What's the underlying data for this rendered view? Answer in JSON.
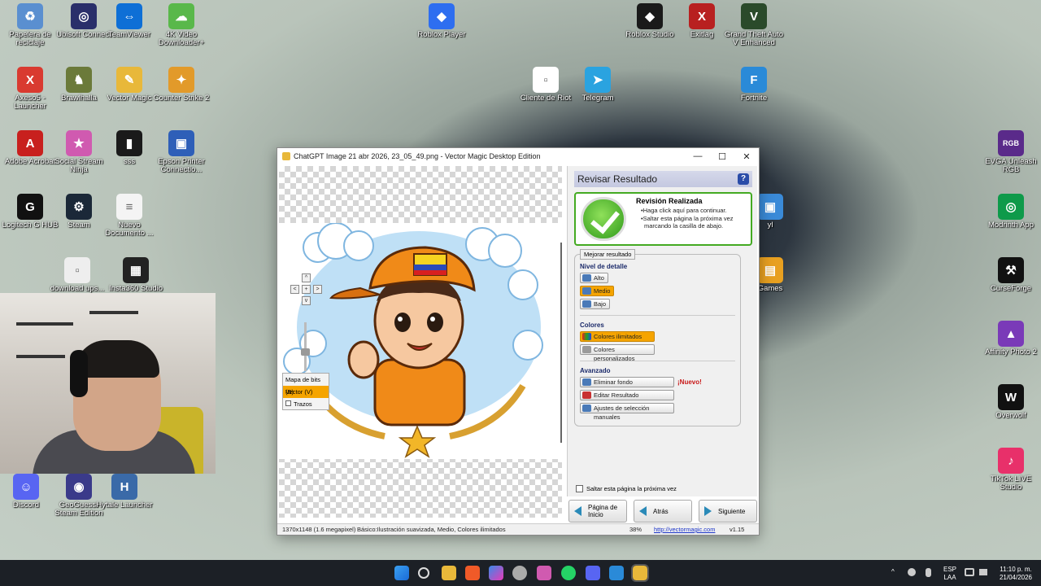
{
  "desktop": {
    "icons": [
      {
        "label": "Papelera de reciclaje",
        "icon": "recycle-bin-icon",
        "color": "#5a8fd0",
        "glyph": "♻"
      },
      {
        "label": "Ubisoft Connect",
        "icon": "ubisoft-icon",
        "color": "#2a2f6a",
        "glyph": "◎"
      },
      {
        "label": "TeamViewer",
        "icon": "teamviewer-icon",
        "color": "#0e6fd6",
        "glyph": "⇔"
      },
      {
        "label": "4K Video Downloader+",
        "icon": "download-icon",
        "color": "#59b84a",
        "glyph": "☁"
      },
      {
        "label": "Axeso5 - Launcher",
        "icon": "axeso-icon",
        "color": "#d93a30",
        "glyph": "X"
      },
      {
        "label": "Brawlhalla",
        "icon": "brawlhalla-icon",
        "color": "#6b7a3a",
        "glyph": "♞"
      },
      {
        "label": "Vector Magic",
        "icon": "vector-magic-icon",
        "color": "#e8b83a",
        "glyph": "✎"
      },
      {
        "label": "Counter Strike 2",
        "icon": "counter-strike-icon",
        "color": "#e29a2a",
        "glyph": "✦"
      },
      {
        "label": "Adobe Acrobat",
        "icon": "acrobat-icon",
        "color": "#c8201e",
        "glyph": "A"
      },
      {
        "label": "Social Stream Ninja",
        "icon": "social-stream-icon",
        "color": "#d05ab0",
        "glyph": "★"
      },
      {
        "label": "sss",
        "icon": "folder-dark-icon",
        "color": "#1a1a1a",
        "glyph": "▮"
      },
      {
        "label": "Epson Printer Connectio...",
        "icon": "epson-icon",
        "color": "#2e5fb8",
        "glyph": "▣"
      },
      {
        "label": "Logitech G HUB",
        "icon": "logitech-icon",
        "color": "#111111",
        "glyph": "G"
      },
      {
        "label": "Steam",
        "icon": "steam-icon",
        "color": "#1b2838",
        "glyph": "⚙"
      },
      {
        "label": "Nuevo Documento ...",
        "icon": "document-icon",
        "color": "#f4f4f4",
        "glyph": "≡"
      },
      {
        "label": "download ups...",
        "icon": "file-icon",
        "color": "#eeeeee",
        "glyph": "▫"
      },
      {
        "label": "Insta360 Studio",
        "icon": "insta360-icon",
        "color": "#222222",
        "glyph": "▦"
      },
      {
        "label": "Discord",
        "icon": "discord-icon",
        "color": "#5865f2",
        "glyph": "☺"
      },
      {
        "label": "GeoGuessr Steam Edition",
        "icon": "geoguessr-icon",
        "color": "#3a3a8a",
        "glyph": "◉"
      },
      {
        "label": "Hytale Launcher",
        "icon": "hytale-icon",
        "color": "#3a6aa8",
        "glyph": "H"
      },
      {
        "label": "Roblox Player",
        "icon": "roblox-icon",
        "color": "#2e6ef0",
        "glyph": "◆"
      },
      {
        "label": "Cliente de Riot",
        "icon": "riot-file-icon",
        "color": "#ffffff",
        "glyph": "▫"
      },
      {
        "label": "Telegram",
        "icon": "telegram-icon",
        "color": "#2aa3e0",
        "glyph": "➤"
      },
      {
        "label": "Roblox Studio",
        "icon": "roblox-studio-icon",
        "color": "#1a1a1a",
        "glyph": "◆"
      },
      {
        "label": "Exitlag",
        "icon": "exitlag-icon",
        "color": "#b82020",
        "glyph": "X"
      },
      {
        "label": "Grand Theft Auto V Enhanced",
        "icon": "gta-icon",
        "color": "#2a4a2a",
        "glyph": "V"
      },
      {
        "label": "Fortnite",
        "icon": "fortnite-icon",
        "color": "#2a8ad8",
        "glyph": "F"
      },
      {
        "label": "EVGA Unleash RGB",
        "icon": "evga-icon",
        "color": "#5a2a8a",
        "glyph": "RGB"
      },
      {
        "label": "Modrinth App",
        "icon": "modrinth-icon",
        "color": "#0e9a4a",
        "glyph": "◎"
      },
      {
        "label": "CurseForge",
        "icon": "curseforge-icon",
        "color": "#111111",
        "glyph": "⚒"
      },
      {
        "label": "Affinity Photo 2",
        "icon": "affinity-icon",
        "color": "#7a3ab8",
        "glyph": "▲"
      },
      {
        "label": "Overwolf",
        "icon": "overwolf-icon",
        "color": "#111111",
        "glyph": "W"
      },
      {
        "label": "TikTok LIVE Studio",
        "icon": "tiktok-icon",
        "color": "#e8306a",
        "glyph": "♪"
      },
      {
        "label": "Games",
        "icon": "games-icon",
        "color": "#e8a020",
        "glyph": "▤"
      },
      {
        "label": "yl",
        "icon": "app-icon",
        "color": "#3a8ad8",
        "glyph": "▣"
      }
    ]
  },
  "window": {
    "title": "ChatGPT Image 21 abr 2026, 23_05_49.png - Vector Magic Desktop Edition",
    "min": "—",
    "max": "☐",
    "close": "✕"
  },
  "canvas": {
    "view_bitmap": "Mapa de bits (B)",
    "view_vector": "Vector (V)",
    "view_strokes": "Trazos"
  },
  "sidebar": {
    "header": "Revisar Resultado",
    "help": "?",
    "done_title": "Revisión Realizada",
    "done_line1": "•Haga click aquí para continuar.",
    "done_line2": "•Saltar esta página la próxima vez",
    "done_line3": "marcando la casilla de abajo.",
    "improve_legend": "Mejorar resultado",
    "detail_title": "Nivel de detalle",
    "detail_high": "Alto",
    "detail_mid": "Medio",
    "detail_low": "Bajo",
    "colors_title": "Colores",
    "colors_limited": "Colores ilimitados",
    "colors_custom": "Colores personalizados",
    "advanced_title": "Avanzado",
    "remove_bg": "Eliminar fondo",
    "new_badge": "¡Nuevo!",
    "edit_result": "Editar Resultado",
    "manual_adjust": "Ajustes de selección manuales",
    "skip_label": "Saltar esta página la próxima vez"
  },
  "nav": {
    "home": "Página de Inicio",
    "back": "Atrás",
    "next": "Siguiente"
  },
  "status": {
    "size": "1370x1148 (1.6 megapixel)",
    "settings": "Básico:Ilustración suavizada, Medio, Colores ilimitados",
    "zoom": "38%",
    "url": "http://vectormagic.com",
    "version": "v1.15"
  },
  "taskbar": {
    "lang1": "ESP",
    "lang2": "LAA",
    "time": "11:10 p. m.",
    "date": "21/04/2026"
  }
}
